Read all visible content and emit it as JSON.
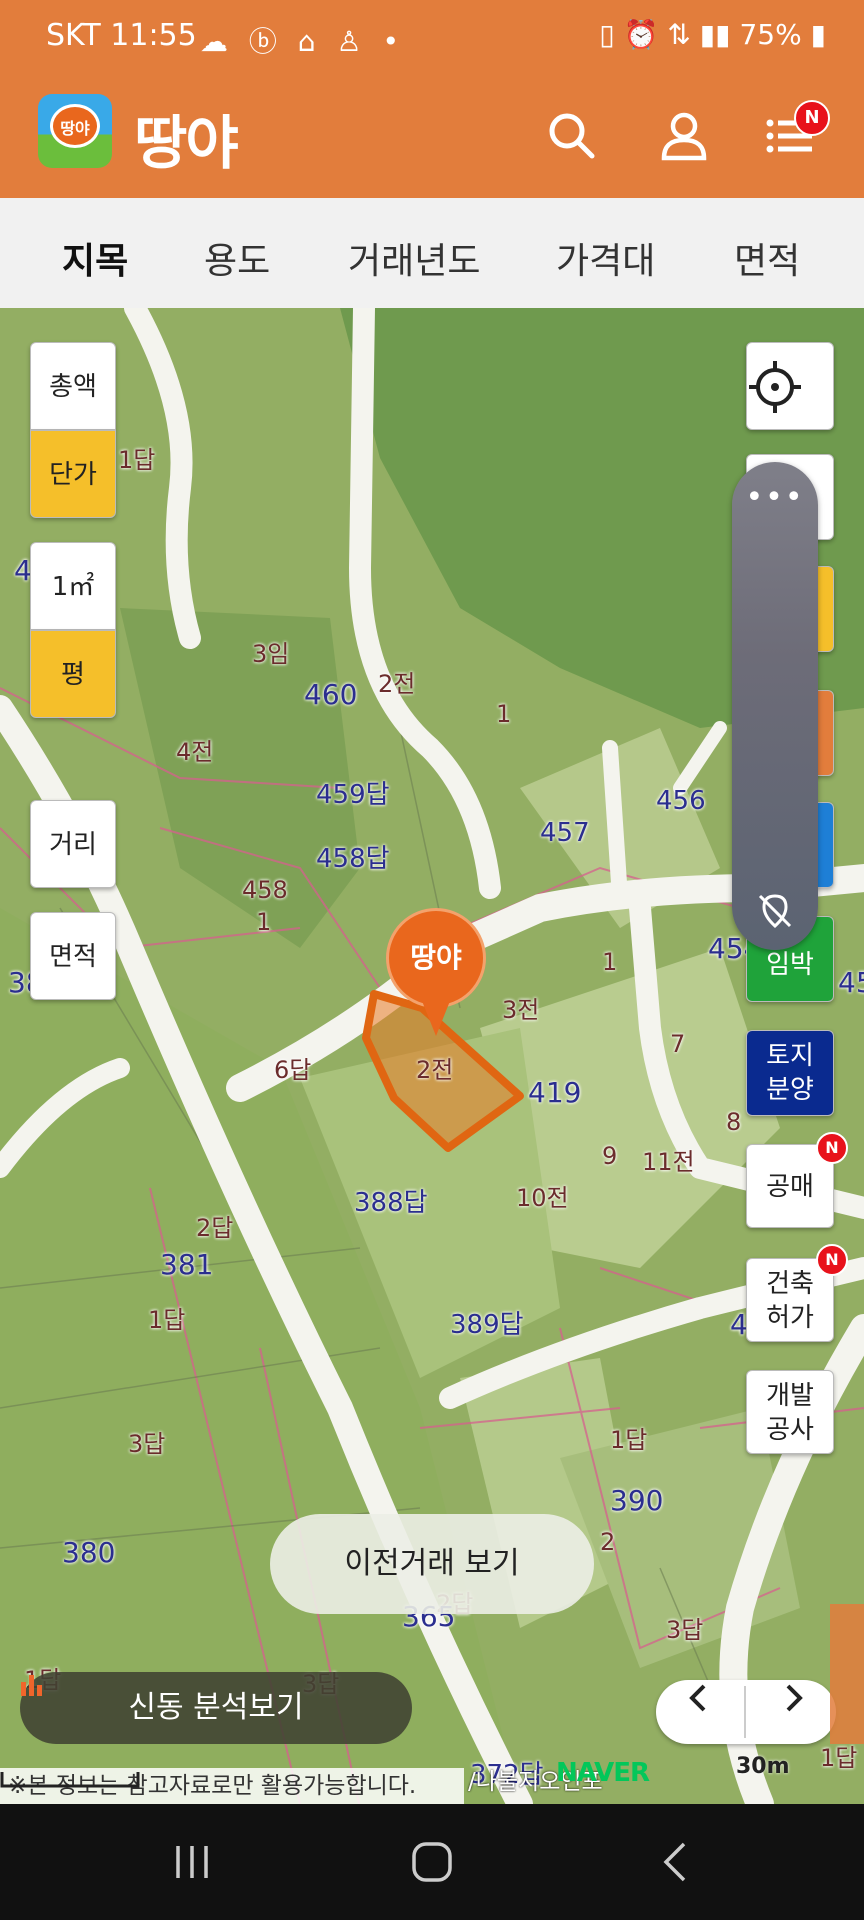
{
  "status_bar": {
    "carrier": "SKT",
    "time": "11:55",
    "battery": "75%"
  },
  "app": {
    "logo_text": "땅야",
    "title": "땅야",
    "menu_badge": "N"
  },
  "tabs": [
    "지목",
    "용도",
    "거래년도",
    "가격대",
    "면적"
  ],
  "left_controls": {
    "total": "총액",
    "unit_price": "단가",
    "sqm": "1㎡",
    "pyeong": "평",
    "distance": "거리",
    "area": "면적"
  },
  "right_controls": {
    "lodging": "임박",
    "land_sale": [
      "토지",
      "분양"
    ],
    "auction": "공매",
    "building_permit": [
      "건축",
      "허가"
    ],
    "development": [
      "개발",
      "공사"
    ],
    "new_badge": "N"
  },
  "map": {
    "pin_label": "땅야",
    "parcel_labels": [
      {
        "t": "1답",
        "cls": ""
      },
      {
        "t": "3임",
        "cls": ""
      },
      {
        "t": "460",
        "cls": "num"
      },
      {
        "t": "2전",
        "cls": ""
      },
      {
        "t": "1",
        "cls": ""
      },
      {
        "t": "4전",
        "cls": ""
      },
      {
        "t": "459답",
        "cls": "num"
      },
      {
        "t": "457",
        "cls": "num"
      },
      {
        "t": "456",
        "cls": "num"
      },
      {
        "t": "458답",
        "cls": "num"
      },
      {
        "t": "458",
        "cls": ""
      },
      {
        "t": "1",
        "cls": ""
      },
      {
        "t": "3전",
        "cls": ""
      },
      {
        "t": "1",
        "cls": ""
      },
      {
        "t": "7",
        "cls": ""
      },
      {
        "t": "6답",
        "cls": ""
      },
      {
        "t": "2전",
        "cls": ""
      },
      {
        "t": "419",
        "cls": "num"
      },
      {
        "t": "8",
        "cls": ""
      },
      {
        "t": "9",
        "cls": ""
      },
      {
        "t": "11전",
        "cls": ""
      },
      {
        "t": "388답",
        "cls": "num"
      },
      {
        "t": "10전",
        "cls": ""
      },
      {
        "t": "2답",
        "cls": ""
      },
      {
        "t": "381",
        "cls": "num"
      },
      {
        "t": "1답",
        "cls": ""
      },
      {
        "t": "389답",
        "cls": "num"
      },
      {
        "t": "3답",
        "cls": ""
      },
      {
        "t": "1답",
        "cls": ""
      },
      {
        "t": "390",
        "cls": "num"
      },
      {
        "t": "380",
        "cls": "num"
      },
      {
        "t": "2",
        "cls": ""
      },
      {
        "t": "2답",
        "cls": ""
      },
      {
        "t": "365",
        "cls": "num"
      },
      {
        "t": "3답",
        "cls": ""
      },
      {
        "t": "1답",
        "cls": ""
      },
      {
        "t": "3답",
        "cls": ""
      },
      {
        "t": "372답",
        "cls": "num"
      },
      {
        "t": "1답",
        "cls": ""
      },
      {
        "t": "4",
        "cls": "num"
      },
      {
        "t": "38",
        "cls": "num"
      },
      {
        "t": "45",
        "cls": "num"
      },
      {
        "t": "4",
        "cls": "num"
      },
      {
        "t": "454",
        "cls": "num"
      }
    ],
    "prev_trade_button": "이전거래 보기",
    "analyze_button": "신동 분석보기",
    "disclaimer": "※본 정보는 참고자료로만 활용가능합니다.",
    "credit": "/나불지오인포",
    "naver": "NAVER",
    "scale": "30m"
  },
  "colors": {
    "brand": "#E27D3C",
    "selected": "#F5BF2A",
    "badge": "#E8121B"
  }
}
